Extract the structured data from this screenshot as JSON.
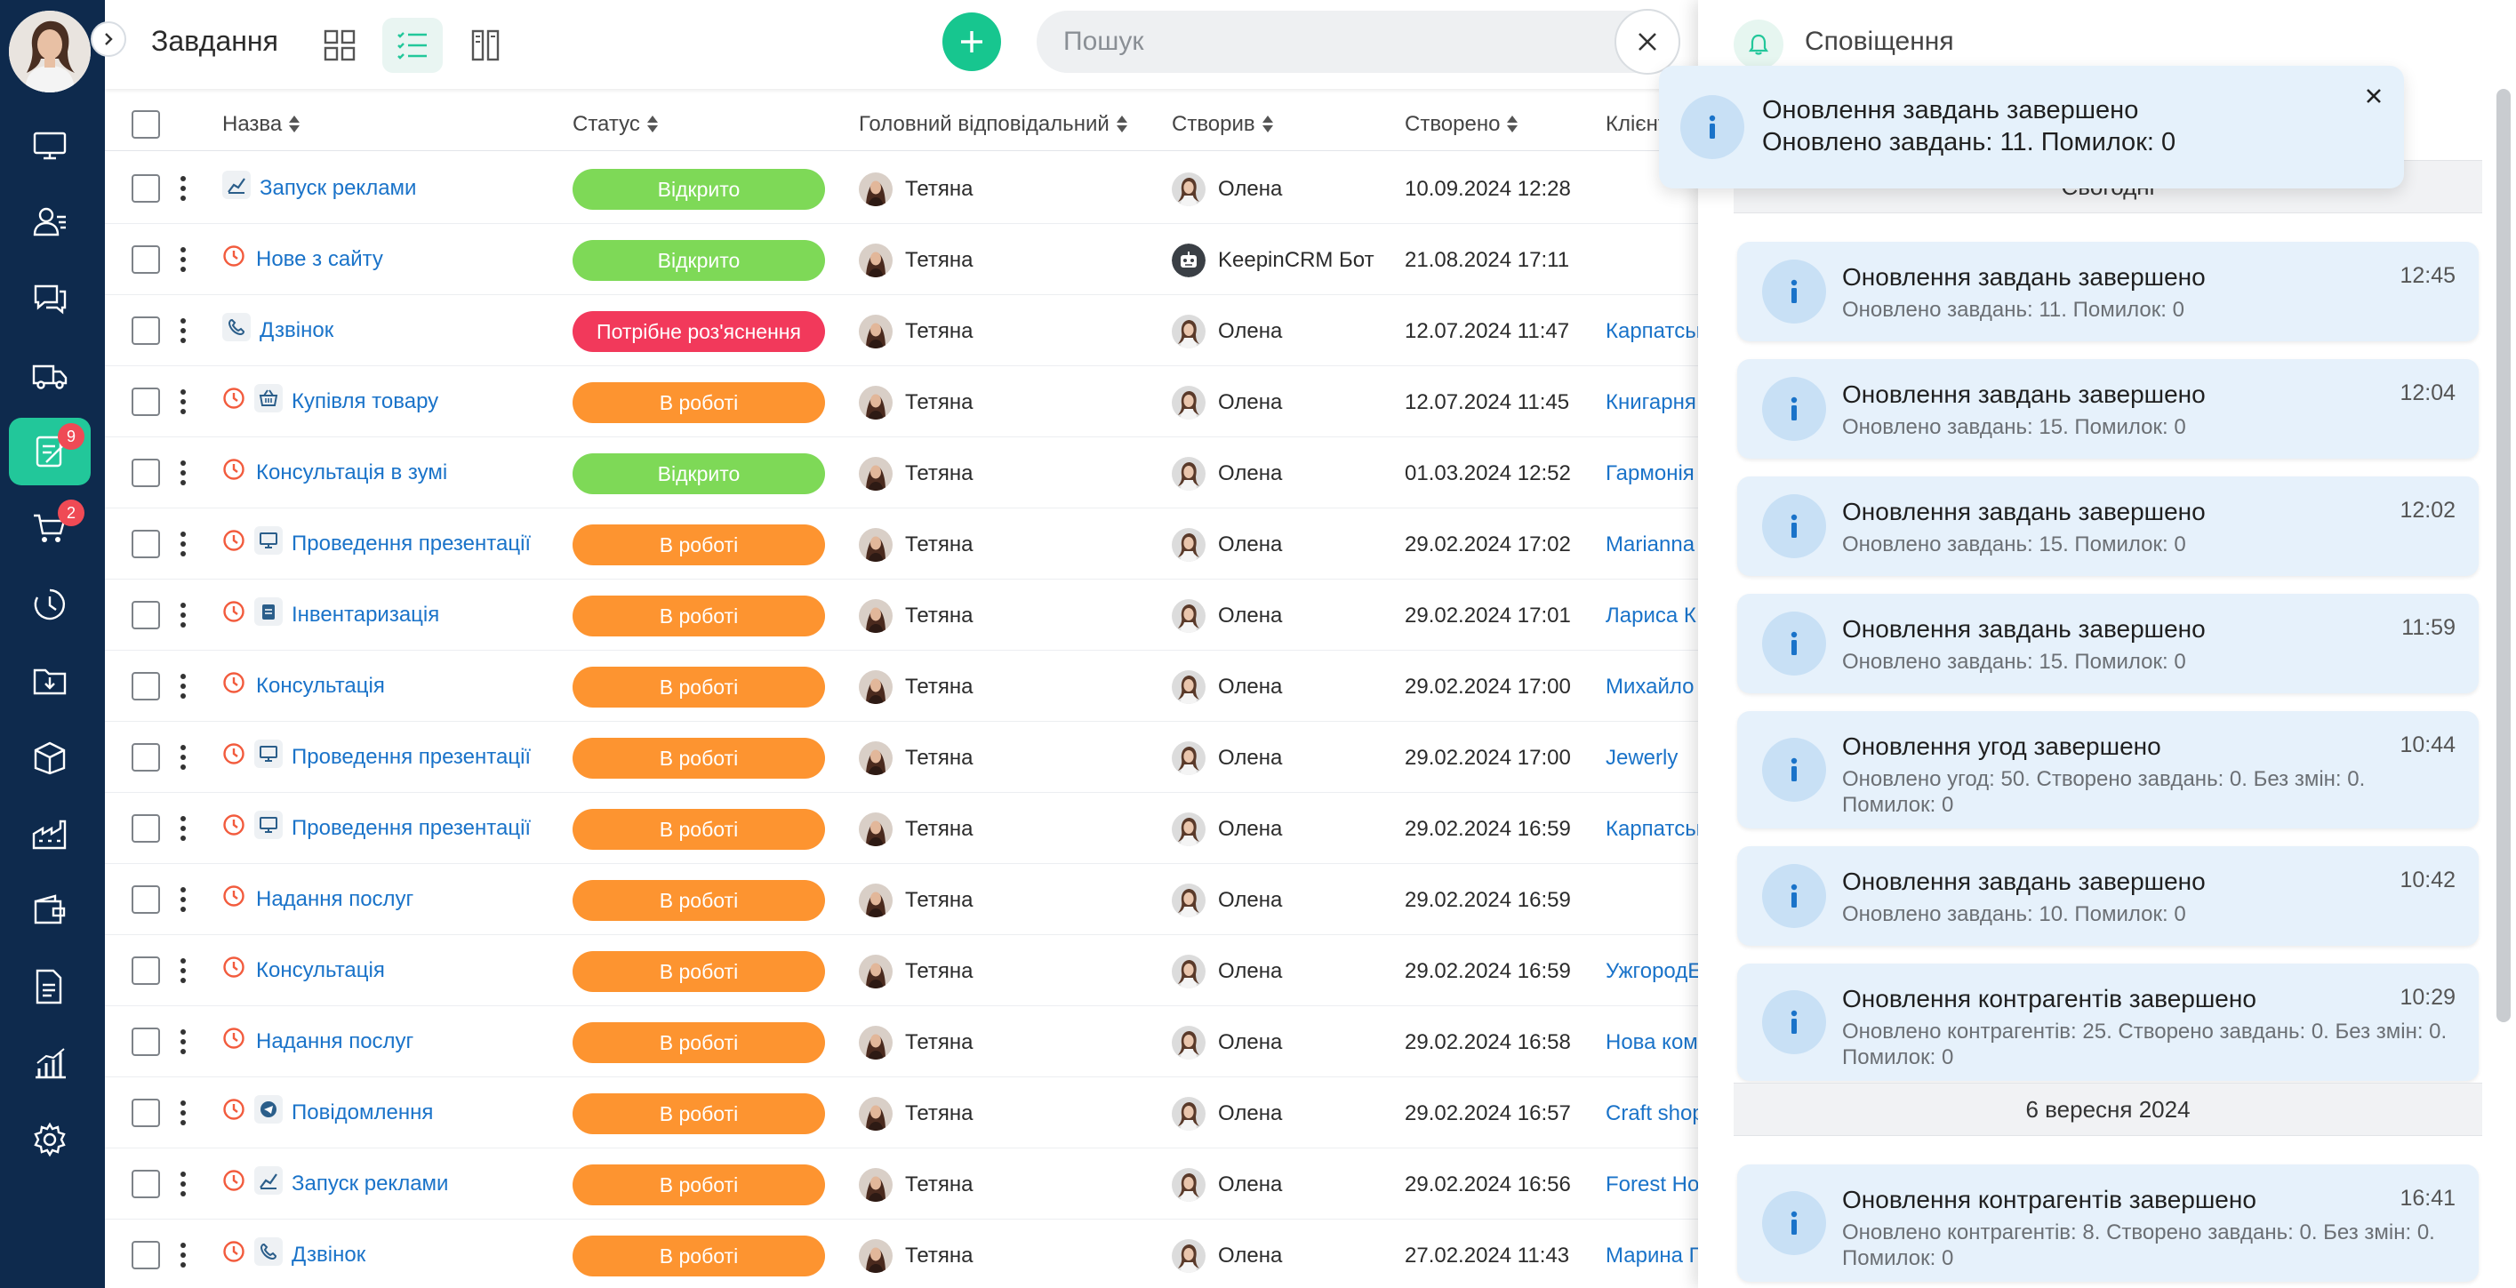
{
  "colors": {
    "sidebar_bg": "#0e2a4d",
    "accent_green": "#22c79a",
    "status_open": "#7ed957",
    "status_in_work": "#fd9430",
    "status_clarify": "#f2395b",
    "link_blue": "#1a73c9",
    "notif_bg": "#e6f1fb"
  },
  "sidebar": {
    "items": [
      {
        "icon": "monitor-icon",
        "active": false,
        "badge": ""
      },
      {
        "icon": "contacts-icon",
        "active": false,
        "badge": ""
      },
      {
        "icon": "chat-icon",
        "active": false,
        "badge": ""
      },
      {
        "icon": "truck-icon",
        "active": false,
        "badge": ""
      },
      {
        "icon": "tasks-icon",
        "active": true,
        "badge": "9"
      },
      {
        "icon": "cart-icon",
        "active": false,
        "badge": "2"
      },
      {
        "icon": "history-icon",
        "active": false,
        "badge": ""
      },
      {
        "icon": "folder-download-icon",
        "active": false,
        "badge": ""
      },
      {
        "icon": "box-icon",
        "active": false,
        "badge": ""
      },
      {
        "icon": "factory-icon",
        "active": false,
        "badge": ""
      },
      {
        "icon": "wallet-icon",
        "active": false,
        "badge": ""
      },
      {
        "icon": "report-icon",
        "active": false,
        "badge": ""
      },
      {
        "icon": "analytics-icon",
        "active": false,
        "badge": ""
      },
      {
        "icon": "settings-icon",
        "active": false,
        "badge": ""
      }
    ]
  },
  "header": {
    "title": "Завдання",
    "search_placeholder": "Пошук"
  },
  "table": {
    "columns": {
      "name": "Назва",
      "status": "Статус",
      "responsible": "Головний відповідальний",
      "creator": "Створив",
      "created": "Створено",
      "client": "Клієнт"
    },
    "rows": [
      {
        "name": "Запуск реклами",
        "icon": "chart-line-icon",
        "clock": false,
        "status": "Відкрито",
        "kind": "open",
        "responsible": "Тетяна",
        "creator": "Олена",
        "creator_bot": false,
        "created": "10.09.2024 12:28",
        "client": ""
      },
      {
        "name": "Нове з сайту",
        "icon": "",
        "clock": true,
        "status": "Відкрито",
        "kind": "open",
        "responsible": "Тетяна",
        "creator": "KeepinCRM Бот",
        "creator_bot": true,
        "created": "21.08.2024 17:11",
        "client": ""
      },
      {
        "name": "Дзвінок",
        "icon": "phone-icon",
        "clock": false,
        "status": "Потрібне роз'яснення",
        "kind": "clarify",
        "responsible": "Тетяна",
        "creator": "Олена",
        "creator_bot": false,
        "created": "12.07.2024 11:47",
        "client": "Карпатськ"
      },
      {
        "name": "Купівля товару",
        "icon": "basket-icon",
        "clock": true,
        "status": "В роботі",
        "kind": "work",
        "responsible": "Тетяна",
        "creator": "Олена",
        "creator_bot": false,
        "created": "12.07.2024 11:45",
        "client": "Книгарня"
      },
      {
        "name": "Консультація в зумі",
        "icon": "",
        "clock": true,
        "status": "Відкрито",
        "kind": "open",
        "responsible": "Тетяна",
        "creator": "Олена",
        "creator_bot": false,
        "created": "01.03.2024 12:52",
        "client": "Гармонія"
      },
      {
        "name": "Проведення презентації",
        "icon": "monitor-icon",
        "clock": true,
        "status": "В роботі",
        "kind": "work",
        "responsible": "Тетяна",
        "creator": "Олена",
        "creator_bot": false,
        "created": "29.02.2024 17:02",
        "client": "Marianna"
      },
      {
        "name": "Інвентаризація",
        "icon": "clipboard-icon",
        "clock": true,
        "status": "В роботі",
        "kind": "work",
        "responsible": "Тетяна",
        "creator": "Олена",
        "creator_bot": false,
        "created": "29.02.2024 17:01",
        "client": "Лариса К"
      },
      {
        "name": "Консультація",
        "icon": "",
        "clock": true,
        "status": "В роботі",
        "kind": "work",
        "responsible": "Тетяна",
        "creator": "Олена",
        "creator_bot": false,
        "created": "29.02.2024 17:00",
        "client": "Михайло"
      },
      {
        "name": "Проведення презентації",
        "icon": "monitor-icon",
        "clock": true,
        "status": "В роботі",
        "kind": "work",
        "responsible": "Тетяна",
        "creator": "Олена",
        "creator_bot": false,
        "created": "29.02.2024 17:00",
        "client": "Jewerly"
      },
      {
        "name": "Проведення презентації",
        "icon": "monitor-icon",
        "clock": true,
        "status": "В роботі",
        "kind": "work",
        "responsible": "Тетяна",
        "creator": "Олена",
        "creator_bot": false,
        "created": "29.02.2024 16:59",
        "client": "Карпатськ"
      },
      {
        "name": "Надання послуг",
        "icon": "",
        "clock": true,
        "status": "В роботі",
        "kind": "work",
        "responsible": "Тетяна",
        "creator": "Олена",
        "creator_bot": false,
        "created": "29.02.2024 16:59",
        "client": ""
      },
      {
        "name": "Консультація",
        "icon": "",
        "clock": true,
        "status": "В роботі",
        "kind": "work",
        "responsible": "Тетяна",
        "creator": "Олена",
        "creator_bot": false,
        "created": "29.02.2024 16:59",
        "client": "УжгородЕ"
      },
      {
        "name": "Надання послуг",
        "icon": "",
        "clock": true,
        "status": "В роботі",
        "kind": "work",
        "responsible": "Тетяна",
        "creator": "Олена",
        "creator_bot": false,
        "created": "29.02.2024 16:58",
        "client": "Нова ком"
      },
      {
        "name": "Повідомлення",
        "icon": "telegram-icon",
        "clock": true,
        "status": "В роботі",
        "kind": "work",
        "responsible": "Тетяна",
        "creator": "Олена",
        "creator_bot": false,
        "created": "29.02.2024 16:57",
        "client": "Craft shop"
      },
      {
        "name": "Запуск реклами",
        "icon": "chart-line-icon",
        "clock": true,
        "status": "В роботі",
        "kind": "work",
        "responsible": "Тетяна",
        "creator": "Олена",
        "creator_bot": false,
        "created": "29.02.2024 16:56",
        "client": "Forest Ho"
      },
      {
        "name": "Дзвінок",
        "icon": "phone-icon",
        "clock": true,
        "status": "В роботі",
        "kind": "work",
        "responsible": "Тетяна",
        "creator": "Олена",
        "creator_bot": false,
        "created": "27.02.2024 11:43",
        "client": "Марина П"
      }
    ]
  },
  "panel": {
    "title": "Сповіщення",
    "today_label": "Сьогодні",
    "notifications": [
      {
        "title": "Оновлення завдань завершено",
        "time": "12:45",
        "body": "Оновлено завдань: 11. Помилок: 0"
      },
      {
        "title": "Оновлення завдань завершено",
        "time": "12:04",
        "body": "Оновлено завдань: 15. Помилок: 0"
      },
      {
        "title": "Оновлення завдань завершено",
        "time": "12:02",
        "body": "Оновлено завдань: 15. Помилок: 0"
      },
      {
        "title": "Оновлення завдань завершено",
        "time": "11:59",
        "body": "Оновлено завдань: 15. Помилок: 0"
      },
      {
        "title": "Оновлення угод завершено",
        "time": "10:44",
        "body": "Оновлено угод: 50. Створено завдань: 0. Без змін: 0. Помилок: 0"
      },
      {
        "title": "Оновлення завдань завершено",
        "time": "10:42",
        "body": "Оновлено завдань: 10. Помилок: 0"
      },
      {
        "title": "Оновлення контрагентів завершено",
        "time": "10:29",
        "body": "Оновлено контрагентів: 25. Створено завдань: 0. Без змін: 0. Помилок: 0"
      }
    ],
    "date2_label": "6 вересня 2024",
    "older_notifications": [
      {
        "title": "Оновлення контрагентів завершено",
        "time": "16:41",
        "body": "Оновлено контрагентів: 8. Створено завдань: 0. Без змін: 0. Помилок: 0"
      }
    ]
  },
  "toast": {
    "title": "Оновлення завдань завершено",
    "body": "Оновлено завдань: 11. Помилок: 0"
  }
}
